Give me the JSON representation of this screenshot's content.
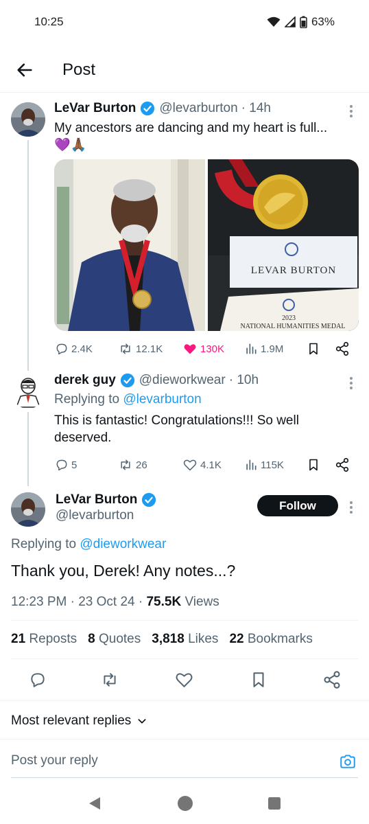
{
  "status_bar": {
    "time": "10:25",
    "battery": "63%"
  },
  "header": {
    "title": "Post"
  },
  "thread": {
    "parent": {
      "name": "LeVar Burton",
      "handle": "@levarburton",
      "time": "· 14h",
      "text": "My ancestors are dancing and my heart is full...",
      "emoji": "💜🙏🏾",
      "image2_card_name": "LEVAR BURTON",
      "image2_year": "2023",
      "image2_medal_title": "NATIONAL HUMANITIES MEDAL",
      "stats": {
        "replies": "2.4K",
        "reposts": "12.1K",
        "likes": "130K",
        "views": "1.9M"
      }
    },
    "reply": {
      "name": "derek guy",
      "handle": "@dieworkwear",
      "time": "· 10h",
      "replying_prefix": "Replying to",
      "replying_to": "@levarburton",
      "text": "This is fantastic! Congratulations!!! So well deserved.",
      "stats": {
        "replies": "5",
        "reposts": "26",
        "likes": "4.1K",
        "views": "115K"
      }
    }
  },
  "main_post": {
    "name": "LeVar Burton",
    "handle": "@levarburton",
    "follow_label": "Follow",
    "replying_prefix": "Replying to",
    "replying_to": "@dieworkwear",
    "text": "Thank you, Derek! Any notes...?",
    "timestamp": "12:23 PM · 23 Oct 24 ·",
    "views_count": "75.5K",
    "views_label": "Views",
    "stats": [
      {
        "num": "21",
        "label": "Reposts"
      },
      {
        "num": "8",
        "label": "Quotes"
      },
      {
        "num": "3,818",
        "label": "Likes"
      },
      {
        "num": "22",
        "label": "Bookmarks"
      }
    ]
  },
  "replies_sort": {
    "label": "Most relevant replies"
  },
  "composer": {
    "placeholder": "Post your reply"
  },
  "colors": {
    "accent": "#1d9bf0",
    "like": "#f91880",
    "text": "#0f1419",
    "muted": "#536471"
  }
}
